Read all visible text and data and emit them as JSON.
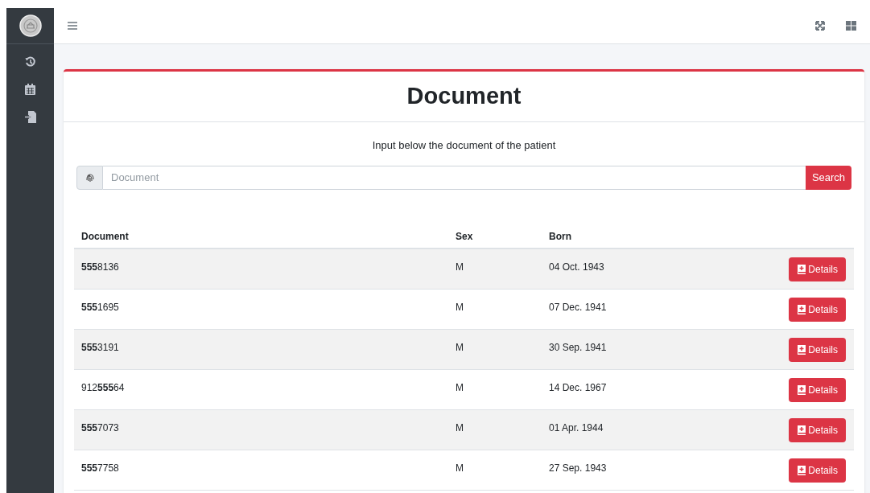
{
  "sidebar": {
    "items": [
      {
        "kind": "history",
        "selected": false
      },
      {
        "kind": "calendar",
        "selected": false
      },
      {
        "kind": "import",
        "selected": false
      }
    ]
  },
  "card": {
    "title": "Document",
    "instruction": "Input below the document of the patient",
    "search": {
      "placeholder": "Document",
      "button": "Search"
    }
  },
  "table": {
    "columns": [
      "Document",
      "Sex",
      "Born"
    ],
    "rows": [
      {
        "document": "**555**8136",
        "sex": "M",
        "born": "04 Oct. 1943",
        "action": "Details"
      },
      {
        "document": "**555**1695",
        "sex": "M",
        "born": "07 Dec. 1941",
        "action": "Details"
      },
      {
        "document": "**555**3191",
        "sex": "M",
        "born": "30 Sep. 1941",
        "action": "Details"
      },
      {
        "document": "912**555**64",
        "sex": "M",
        "born": "14 Dec. 1967",
        "action": "Details"
      },
      {
        "document": "**555**7073",
        "sex": "M",
        "born": "01 Apr. 1944",
        "action": "Details"
      },
      {
        "document": "**555**7758",
        "sex": "M",
        "born": "27 Sep. 1943",
        "action": "Details"
      }
    ]
  }
}
